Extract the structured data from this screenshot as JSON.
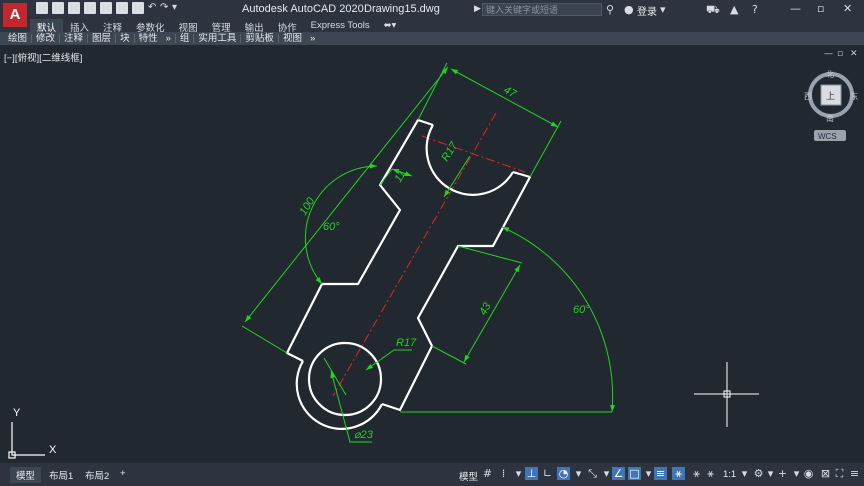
{
  "app": {
    "logo_letter": "A",
    "title": "Autodesk AutoCAD 2020",
    "file": "Drawing15.dwg"
  },
  "quick_access": {
    "icons": [
      "new-icon",
      "open-icon",
      "save-icon",
      "save-as-icon",
      "open-web-icon",
      "save-web-icon",
      "plot-icon",
      "undo-icon",
      "redo-icon",
      "customize-icon"
    ]
  },
  "search": {
    "placeholder": "键入关键字或短语"
  },
  "header": {
    "login_label": "登录"
  },
  "ribbon": {
    "tabs": [
      "默认",
      "插入",
      "注释",
      "参数化",
      "视图",
      "管理",
      "输出",
      "协作",
      "Express Tools"
    ],
    "active_tab": "默认",
    "panels": [
      "绘图",
      "修改",
      "注释",
      "图层",
      "块",
      "特性",
      "»",
      "组",
      "实用工具",
      "剪贴板",
      "视图",
      "»"
    ]
  },
  "viewport": {
    "label": "[−][俯视][二维线框]"
  },
  "viewcube": {
    "north": "北",
    "south": "南",
    "east": "东",
    "west": "西",
    "top": "上",
    "wcs": "WCS"
  },
  "ucs": {
    "x": "X",
    "y": "Y"
  },
  "drawing": {
    "dim_47": "47",
    "dim_100": "100",
    "dim_r17_top": "R17",
    "dim_11": "11",
    "dim_60_left": "60°",
    "dim_60_right": "60°",
    "dim_43": "43",
    "dim_r17_bottom": "R17",
    "dim_dia23": "⌀23"
  },
  "layout_tabs": {
    "model": "模型",
    "layout1": "布局1",
    "layout2": "布局2",
    "add": "+"
  },
  "status": {
    "model_label": "模型",
    "scale": "1:1"
  },
  "colors": {
    "dimension": "#22d41e",
    "geometry": "#ffffff",
    "centerline": "#e0281e",
    "background": "#212830"
  }
}
